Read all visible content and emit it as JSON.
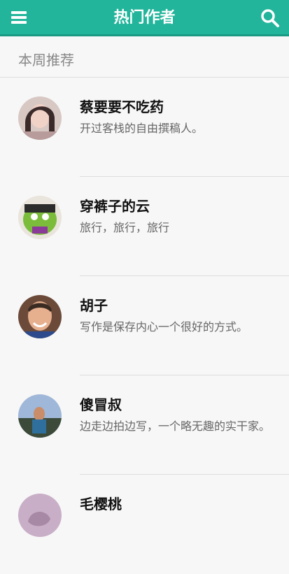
{
  "header": {
    "title": "热门作者"
  },
  "section": {
    "label": "本周推荐"
  },
  "authors": [
    {
      "name": "蔡要要不吃药",
      "desc": "开过客栈的自由撰稿人。"
    },
    {
      "name": "穿裤子的云",
      "desc": "旅行，旅行，旅行"
    },
    {
      "name": "胡子",
      "desc": "写作是保存内心一个很好的方式。"
    },
    {
      "name": "傻冒叔",
      "desc": "边走边拍边写，一个略无趣的实干家。"
    },
    {
      "name": "毛樱桃",
      "desc": ""
    }
  ],
  "icons": {
    "menu": "menu-icon",
    "search": "search-icon"
  },
  "colors": {
    "accent": "#22b59b",
    "background": "#f7f7f7"
  }
}
